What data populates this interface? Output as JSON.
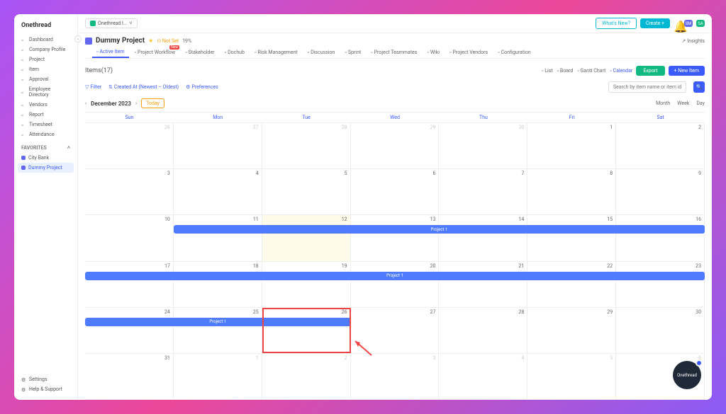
{
  "logo": "Onethread",
  "sidebar": {
    "items": [
      {
        "icon": "dash",
        "label": "Dashboard"
      },
      {
        "icon": "comp",
        "label": "Company Profile"
      },
      {
        "icon": "proj",
        "label": "Project"
      },
      {
        "icon": "item",
        "label": "Item"
      },
      {
        "icon": "appr",
        "label": "Approval"
      },
      {
        "icon": "emp",
        "label": "Employee Directory"
      },
      {
        "icon": "vend",
        "label": "Vendors"
      },
      {
        "icon": "rep",
        "label": "Report"
      },
      {
        "icon": "time",
        "label": "Timesheet"
      },
      {
        "icon": "att",
        "label": "Attendance"
      }
    ],
    "favorites_label": "FAVORITES",
    "favorites": [
      {
        "label": "City Bank"
      },
      {
        "label": "Dummy Project"
      }
    ],
    "footer": [
      {
        "label": "Settings"
      },
      {
        "label": "Help & Support"
      }
    ]
  },
  "topbar": {
    "workspace": "Onethread I...",
    "whats_new": "What's New?",
    "create": "Create +",
    "avatar1": "SM",
    "avatar2": "SA"
  },
  "project": {
    "title": "Dummy Project",
    "not_set": "⊙ Not Set",
    "pct": "19%",
    "insights": "Insights"
  },
  "tabs": [
    {
      "label": "Active Item",
      "active": true
    },
    {
      "label": "Project Workflow",
      "badge": "New"
    },
    {
      "label": "Stakeholder"
    },
    {
      "label": "Dochub"
    },
    {
      "label": "Risk Management"
    },
    {
      "label": "Discussion"
    },
    {
      "label": "Sprint"
    },
    {
      "label": "Project Teammates"
    },
    {
      "label": "Wiki"
    },
    {
      "label": "Project Vendors"
    },
    {
      "label": "Configuration"
    }
  ],
  "items": {
    "title": "Items(17)",
    "views": [
      {
        "label": "List"
      },
      {
        "label": "Board"
      },
      {
        "label": "Gantt Chart"
      },
      {
        "label": "Calendar",
        "active": true
      }
    ],
    "export": "Export",
    "new_item": "+ New Item"
  },
  "filters": {
    "filter": "Filter",
    "sort": "Created At (Newest – Oldest)",
    "prefs": "Preferences",
    "search_placeholder": "Search by item name or item id"
  },
  "datenav": {
    "month": "December 2023",
    "today": "Today",
    "periods": [
      "Month",
      "Week",
      "Day"
    ]
  },
  "calendar": {
    "days": [
      "Sun",
      "Mon",
      "Tue",
      "Wed",
      "Thu",
      "Fri",
      "Sat"
    ],
    "weeks": [
      [
        {
          "d": "26",
          "dim": true
        },
        {
          "d": "27",
          "dim": true
        },
        {
          "d": "28",
          "dim": true
        },
        {
          "d": "29",
          "dim": true
        },
        {
          "d": "30",
          "dim": true
        },
        {
          "d": "1"
        },
        {
          "d": "2"
        }
      ],
      [
        {
          "d": "3"
        },
        {
          "d": "4"
        },
        {
          "d": "5"
        },
        {
          "d": "6"
        },
        {
          "d": "7"
        },
        {
          "d": "8"
        },
        {
          "d": "9"
        }
      ],
      [
        {
          "d": "10"
        },
        {
          "d": "11"
        },
        {
          "d": "12",
          "today": true
        },
        {
          "d": "13"
        },
        {
          "d": "14"
        },
        {
          "d": "15"
        },
        {
          "d": "16"
        }
      ],
      [
        {
          "d": "17"
        },
        {
          "d": "18"
        },
        {
          "d": "19"
        },
        {
          "d": "20"
        },
        {
          "d": "21"
        },
        {
          "d": "22"
        },
        {
          "d": "23"
        }
      ],
      [
        {
          "d": "24"
        },
        {
          "d": "25"
        },
        {
          "d": "26"
        },
        {
          "d": "27"
        },
        {
          "d": "28"
        },
        {
          "d": "29"
        },
        {
          "d": "30"
        }
      ],
      [
        {
          "d": "31"
        },
        {
          "d": "1",
          "dim": true
        },
        {
          "d": "2",
          "dim": true
        },
        {
          "d": "3",
          "dim": true
        },
        {
          "d": "4",
          "dim": true
        },
        {
          "d": "5",
          "dim": true
        },
        {
          "d": "6",
          "dim": true
        }
      ]
    ],
    "events": [
      {
        "label": "Project 1",
        "row": 2,
        "start": 1,
        "end": 7
      },
      {
        "label": "Project 1",
        "row": 3,
        "start": 0,
        "end": 7
      },
      {
        "label": "Project 1",
        "row": 4,
        "start": 0,
        "end": 3
      }
    ]
  },
  "chat_label": "Onethread"
}
